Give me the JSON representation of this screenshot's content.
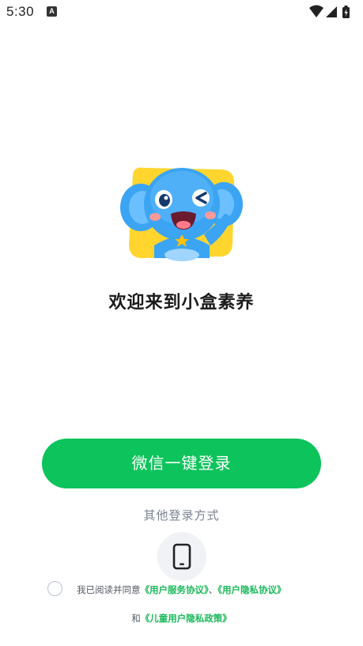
{
  "status_bar": {
    "time": "5:30",
    "notification_icon_letter": "A",
    "icons": [
      "wifi-icon",
      "cell-signal-icon",
      "battery-icon"
    ]
  },
  "mascot": {
    "icon": "elephant-mascot-icon",
    "colors": {
      "tile": "#ffd52e",
      "body": "#3ba4f3",
      "cheek": "#ff9a9a"
    }
  },
  "welcome": {
    "title": "欢迎来到小盒素养"
  },
  "login": {
    "wechat_button_label": "微信一键登录",
    "other_methods_label": "其他登录方式",
    "phone_icon": "phone-icon"
  },
  "agreement": {
    "prefix": "我已阅读并同意",
    "user_service_link": "《用户服务协议》",
    "separator": "、",
    "user_privacy_link": "《用户隐私协议》",
    "and_text": "和",
    "child_privacy_link": "《儿童用户隐私政策》",
    "checked": false
  },
  "colors": {
    "accent_green": "#0dc35b",
    "link_green": "#19b95a",
    "text_dark": "#1a1a1a",
    "text_gray": "#7a8290"
  }
}
